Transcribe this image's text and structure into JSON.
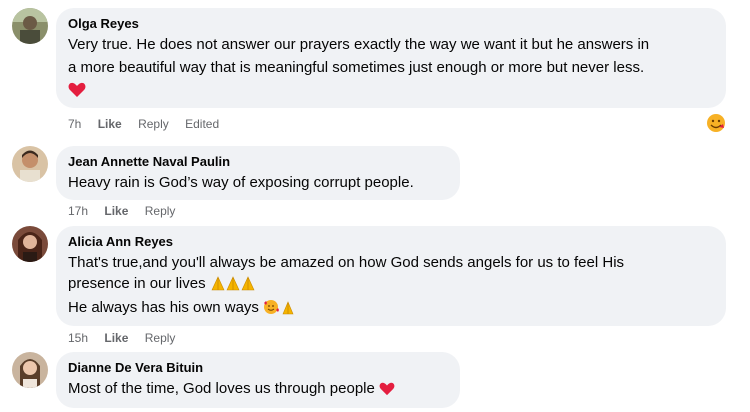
{
  "comments": [
    {
      "author": "Olga Reyes",
      "text_line1": "Very true. He does not answer our prayers exactly the way we want it but he answers in",
      "text_line2": "a more beautiful way that is meaningful sometimes just enough or more but never less.",
      "time": "7h",
      "like": "Like",
      "reply": "Reply",
      "edited": "Edited"
    },
    {
      "author": "Jean Annette Naval Paulin",
      "text_line1": "Heavy rain is God’s way of exposing corrupt people.",
      "time": "17h",
      "like": "Like",
      "reply": "Reply"
    },
    {
      "author": "Alicia Ann Reyes",
      "text_line1": "That's true,and you'll always be amazed on how God sends angels for us to feel His",
      "text_line2": "presence in our lives",
      "text_line3": "He always has his own ways",
      "time": "15h",
      "like": "Like",
      "reply": "Reply"
    },
    {
      "author": "Dianne De Vera Bituin",
      "text_line1": "Most of the time, God loves us through people"
    }
  ],
  "colors": {
    "bubble": "#f0f2f5",
    "meta": "#65676b",
    "heart": "#e41e3f",
    "pray": "#f5b400"
  },
  "icons": [
    "heart-emoji-icon",
    "reaction-emoji-icon",
    "praying-hands-icon",
    "smiling-face-with-hearts-icon"
  ]
}
